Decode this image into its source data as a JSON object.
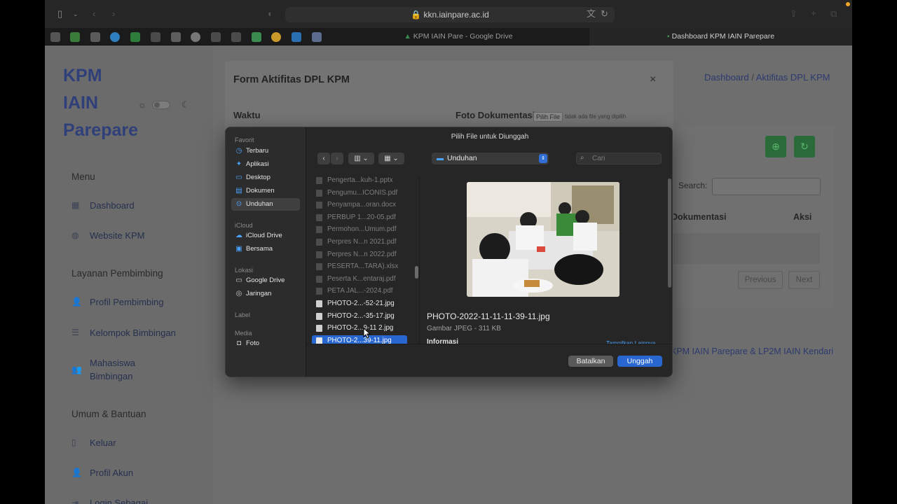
{
  "browser": {
    "url": "kkn.iainpare.ac.id",
    "tabs": [
      {
        "label": "KPM IAIN Pare - Google Drive"
      },
      {
        "label": "Dashboard KPM IAIN Parepare"
      }
    ]
  },
  "sidebar": {
    "brand": "KPM IAIN Parepare",
    "sections": {
      "menu": "Menu",
      "layanan": "Layanan Pembimbing",
      "umum": "Umum & Bantuan"
    },
    "items": [
      {
        "label": "Dashboard"
      },
      {
        "label": "Website KPM"
      },
      {
        "label": "Profil Pembimbing"
      },
      {
        "label": "Kelompok Bimbingan"
      },
      {
        "label": "Mahasiswa Bimbingan"
      },
      {
        "label": "Keluar"
      },
      {
        "label": "Profil Akun"
      },
      {
        "label": "Login Sebagai"
      }
    ]
  },
  "breadcrumb": {
    "home": "Dashboard",
    "sep": "/",
    "current": "Aktifitas DPL KPM"
  },
  "table": {
    "search_label": "Search:",
    "col_dokumentasi": "Dokumentasi",
    "col_aksi": "Aksi",
    "previous": "Previous",
    "next": "Next"
  },
  "footer": {
    "text": "KPM IAIN Parepare & LP2M IAIN Kendari"
  },
  "modal": {
    "title": "Form Aktifitas DPL KPM",
    "close": "×",
    "field_waktu": "Waktu",
    "field_foto": "Foto Dokumentasi",
    "choose_file": "Pilih File",
    "no_file": "tidak ada file yang dipilih"
  },
  "file_dialog": {
    "title": "Pilih File untuk Diunggah",
    "location": "Unduhan",
    "search_placeholder": "Cari",
    "sidebar": {
      "favorit": "Favorit",
      "favorit_items": [
        "Terbaru",
        "Aplikasi",
        "Desktop",
        "Dokumen",
        "Unduhan"
      ],
      "icloud": "iCloud",
      "icloud_items": [
        "iCloud Drive",
        "Bersama"
      ],
      "lokasi": "Lokasi",
      "lokasi_items": [
        "Google Drive",
        "Jaringan"
      ],
      "label": "Label",
      "media": "Media",
      "media_items": [
        "Foto"
      ]
    },
    "files": [
      {
        "name": "Pengerta...kuh-1.pptx",
        "state": "dim"
      },
      {
        "name": "Pengumu...ICONIS.pdf",
        "state": "dim"
      },
      {
        "name": "Penyampa...oran.docx",
        "state": "dim"
      },
      {
        "name": "PERBUP 1...20-05.pdf",
        "state": "dim"
      },
      {
        "name": "Permohon...Umum.pdf",
        "state": "dim"
      },
      {
        "name": "Perpres N...n 2021.pdf",
        "state": "dim"
      },
      {
        "name": "Perpres N...n 2022.pdf",
        "state": "dim"
      },
      {
        "name": "PESERTA...TARA).xlsx",
        "state": "dim"
      },
      {
        "name": "Peserta K...entaraj.pdf",
        "state": "dim"
      },
      {
        "name": "PETA JAL...-2024.pdf",
        "state": "dim"
      },
      {
        "name": "PHOTO-2...-52-21.jpg",
        "state": "norm"
      },
      {
        "name": "PHOTO-2...-35-17.jpg",
        "state": "norm"
      },
      {
        "name": "PHOTO-2...9-11 2.jpg",
        "state": "norm"
      },
      {
        "name": "PHOTO-2...39-11.jpg",
        "state": "sel"
      }
    ],
    "preview": {
      "filename": "PHOTO-2022-11-11-11-39-11.jpg",
      "info": "Gambar JPEG - 311 KB",
      "info_heading": "Informasi",
      "show_more": "Tampilkan Lainnya"
    },
    "cancel": "Batalkan",
    "upload": "Unggah"
  }
}
